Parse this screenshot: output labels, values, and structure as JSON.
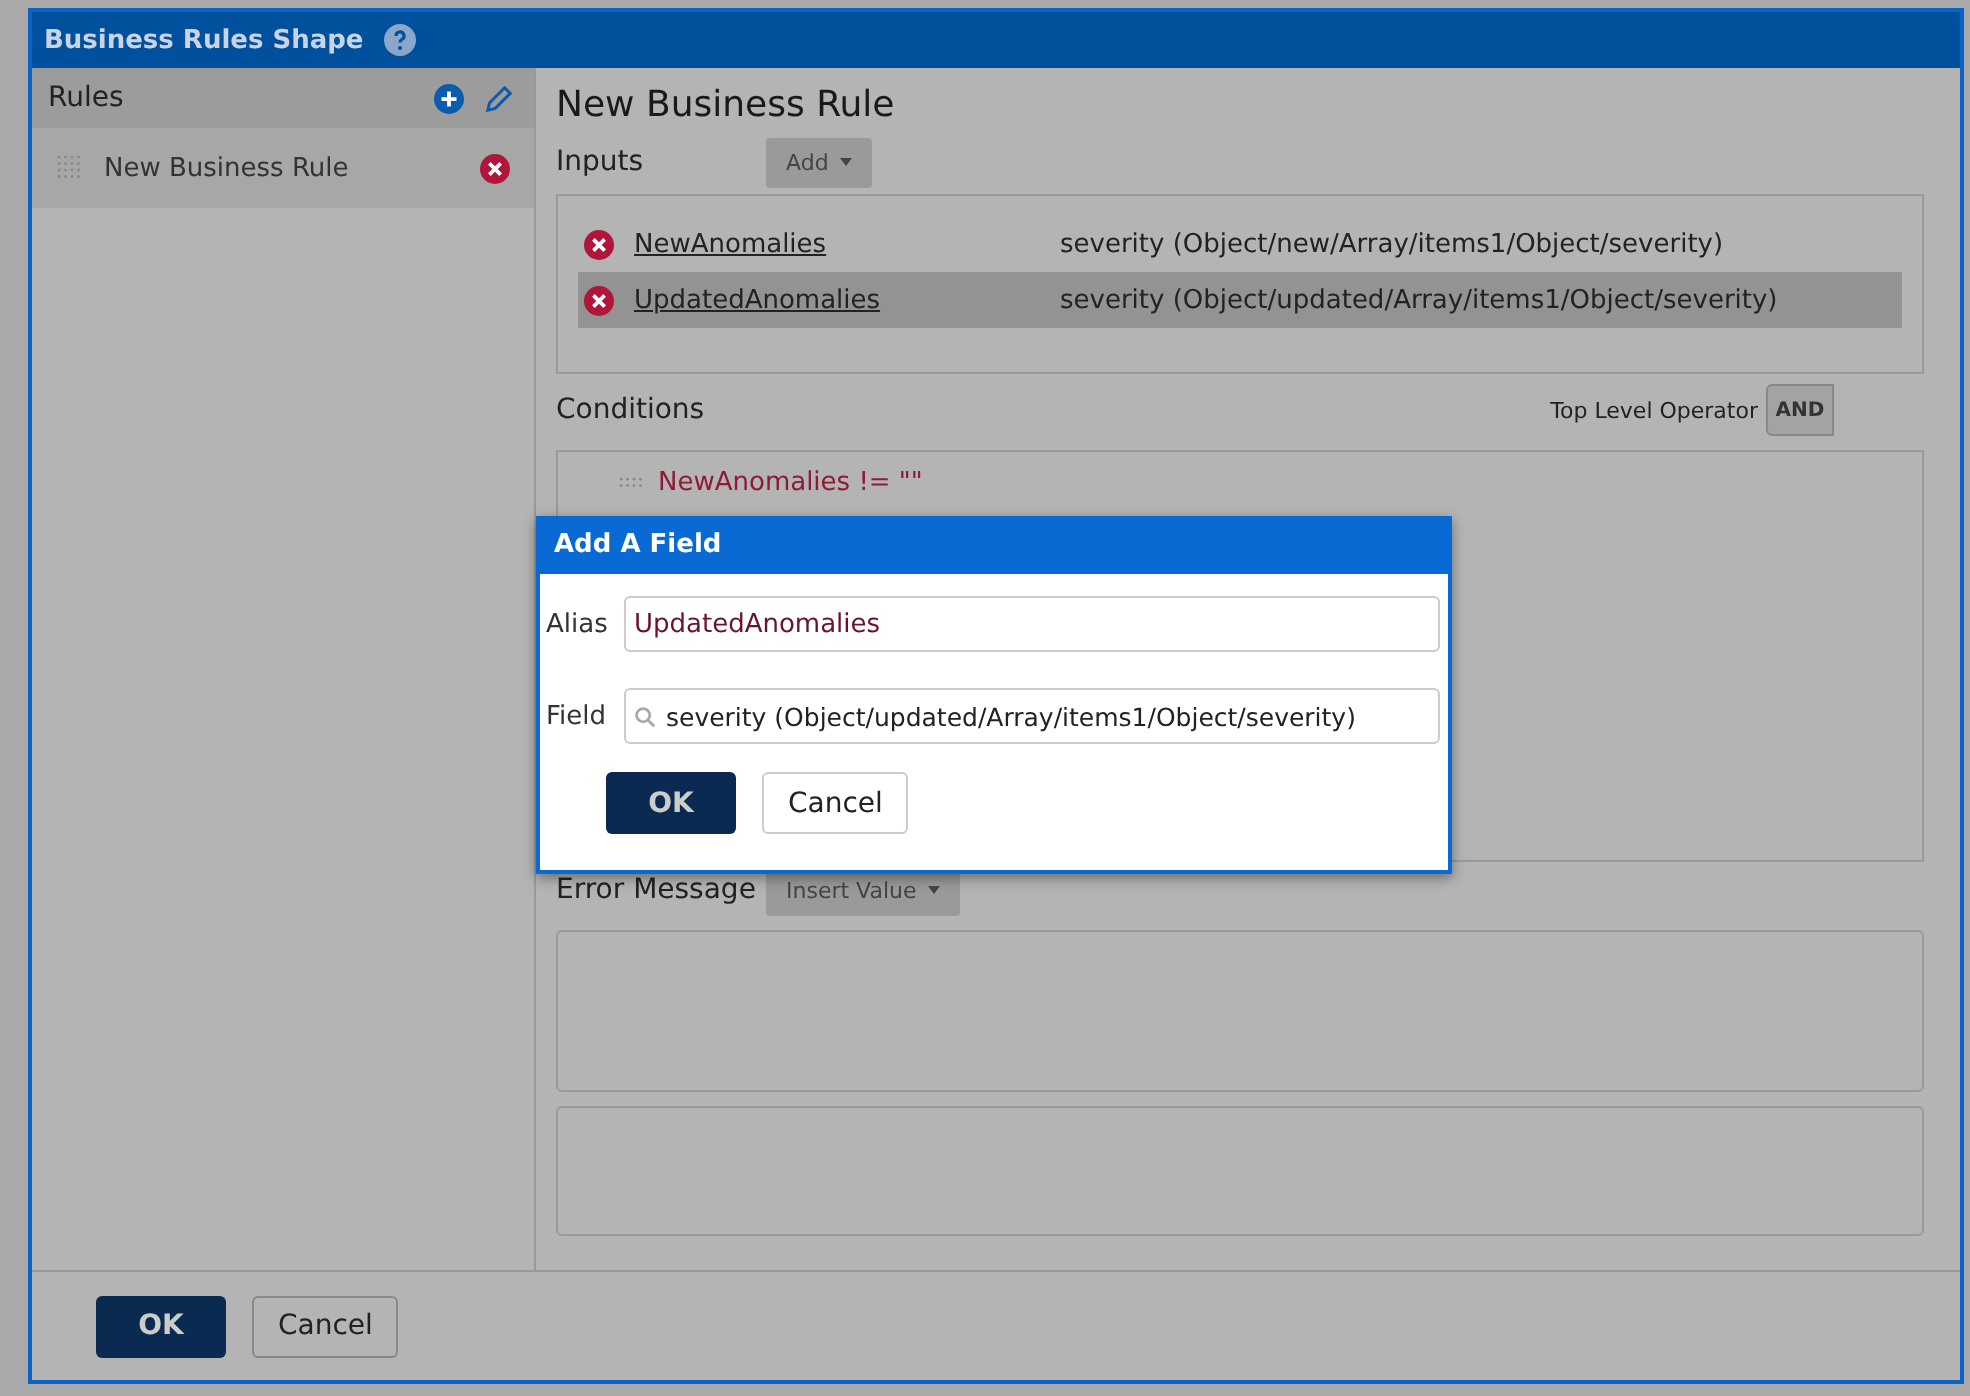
{
  "window": {
    "title": "Business Rules Shape"
  },
  "rules": {
    "title": "Rules",
    "items": [
      {
        "label": "New Business Rule",
        "selected": true
      }
    ]
  },
  "rule": {
    "title": "New Business Rule",
    "inputs": {
      "title": "Inputs",
      "add_button": "Add",
      "rows": [
        {
          "alias": "NewAnomalies",
          "field": "severity (Object/new/Array/items1/Object/severity)",
          "selected": false
        },
        {
          "alias": "UpdatedAnomalies",
          "field": "severity (Object/updated/Array/items1/Object/severity)",
          "selected": true
        }
      ]
    },
    "conditions": {
      "title": "Conditions",
      "operator_label": "Top Level Operator",
      "operator": "AND",
      "items": [
        "NewAnomalies != \"\""
      ]
    },
    "error_message": {
      "title": "Error Message",
      "insert_button": "Insert Value"
    }
  },
  "footer": {
    "ok": "OK",
    "cancel": "Cancel"
  },
  "add_field_dialog": {
    "title": "Add A Field",
    "alias_label": "Alias",
    "alias": "UpdatedAnomalies",
    "field_label": "Field",
    "field": "severity (Object/updated/Array/items1/Object/severity)",
    "ok": "OK",
    "cancel": "Cancel"
  }
}
